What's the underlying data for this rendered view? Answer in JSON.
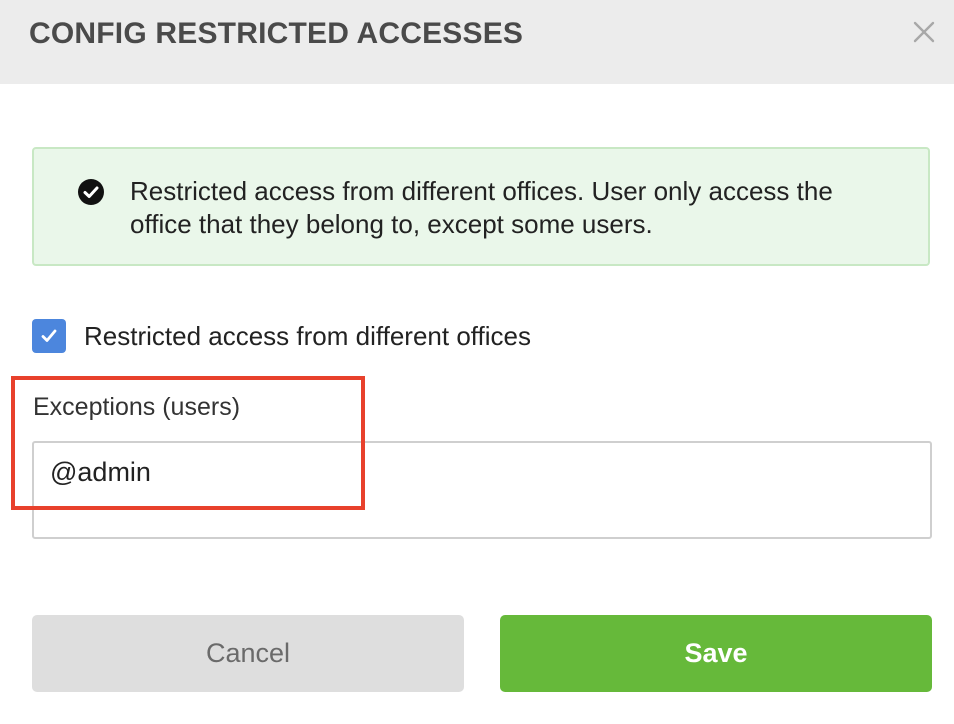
{
  "dialog": {
    "title": "CONFIG RESTRICTED ACCESSES",
    "close_icon": "close-x-icon"
  },
  "notice": {
    "icon": "check-circle-icon",
    "text": "Restricted access from different offices. User only access the office that they belong to, except some users."
  },
  "restriction": {
    "checked": true,
    "label": "Restricted access from different offices"
  },
  "exceptions": {
    "label": "Exceptions (users)",
    "value": "@admin"
  },
  "actions": {
    "cancel_label": "Cancel",
    "save_label": "Save"
  },
  "colors": {
    "header_bg": "#ececec",
    "notice_bg": "#eaf7ea",
    "notice_border": "#c8e8c4",
    "checkbox": "#4c86dd",
    "save": "#66b93a",
    "cancel": "#dedede",
    "highlight": "#e8412c"
  }
}
